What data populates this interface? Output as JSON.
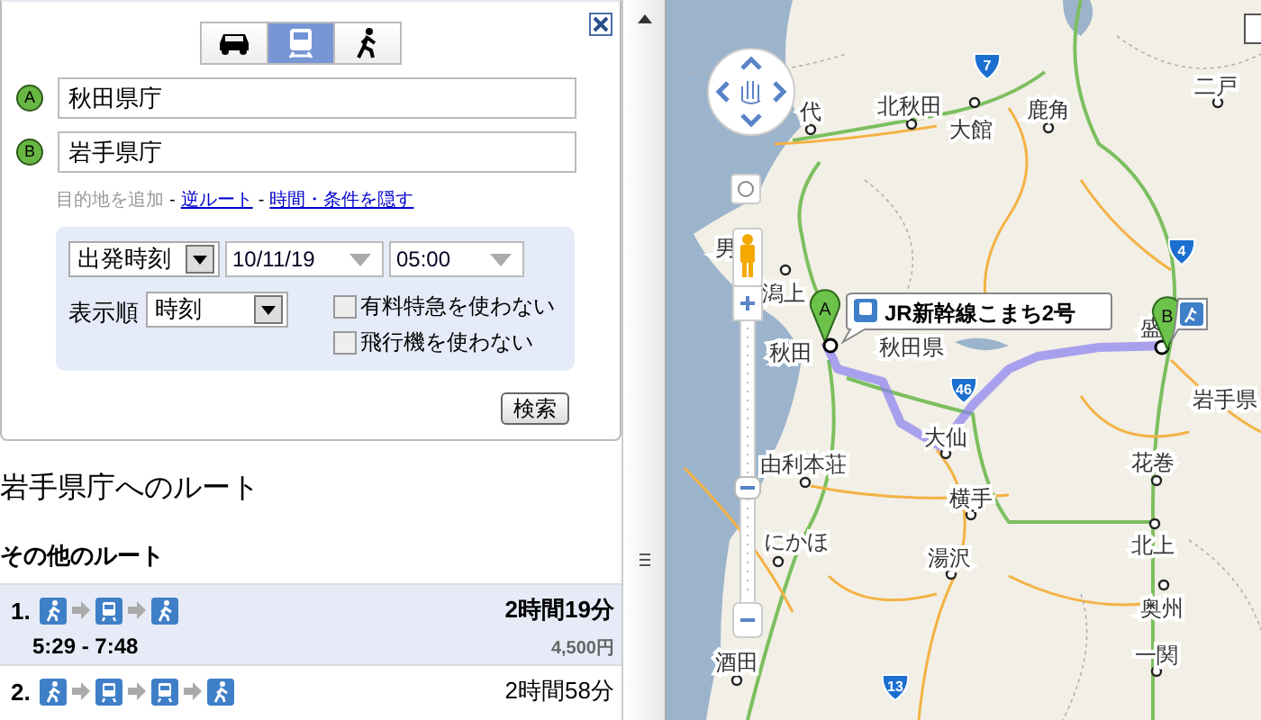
{
  "panel": {
    "travel_modes": [
      {
        "kind": "car",
        "selected": false
      },
      {
        "kind": "transit",
        "selected": true
      },
      {
        "kind": "walk",
        "selected": false
      }
    ],
    "waypoints": [
      {
        "marker": "A",
        "value": "秋田県庁"
      },
      {
        "marker": "B",
        "value": "岩手県庁"
      }
    ],
    "add_destination": "目的地を追加",
    "links": [
      {
        "separator": "-",
        "label": "逆ルート"
      },
      {
        "separator": "-",
        "label": "時間・条件を隠す"
      }
    ],
    "options": {
      "time_type": "出発時刻",
      "date": "10/11/19",
      "time": "05:00",
      "sort_label": "表示順",
      "sort": "時刻",
      "checkboxes": [
        {
          "label": "有料特急を使わない",
          "checked": false
        },
        {
          "label": "飛行機を使わない",
          "checked": false
        }
      ]
    },
    "search_button": "検索"
  },
  "results": {
    "title": "岩手県庁へのルート",
    "heading": "その他のルート",
    "routes": [
      {
        "number": "1.",
        "steps": [
          {
            "kind": "walk"
          },
          {
            "kind": "train"
          },
          {
            "kind": "walk"
          }
        ],
        "duration": "2時間19分",
        "times": "5:29 - 7:48",
        "fare": "4,500円",
        "selected": true
      },
      {
        "number": "2.",
        "steps": [
          {
            "kind": "walk"
          },
          {
            "kind": "train"
          },
          {
            "kind": "train"
          },
          {
            "kind": "walk"
          }
        ],
        "duration": "2時間58分",
        "selected": false
      }
    ]
  },
  "map": {
    "places": [
      "代",
      "北秋田",
      "大館",
      "鹿角",
      "二戸",
      "男",
      "潟上",
      "秋田",
      "秋田県",
      "盛",
      "岩手県",
      "大仙",
      "由利本荘",
      "横手",
      "にかほ",
      "湯沢",
      "花巻",
      "北上",
      "奥州",
      "酒田",
      "一関"
    ],
    "road_shields": [
      "7",
      "4",
      "46",
      "13"
    ],
    "markers": [
      "A",
      "B"
    ],
    "callout": "JR新幹線こまち2号"
  }
}
